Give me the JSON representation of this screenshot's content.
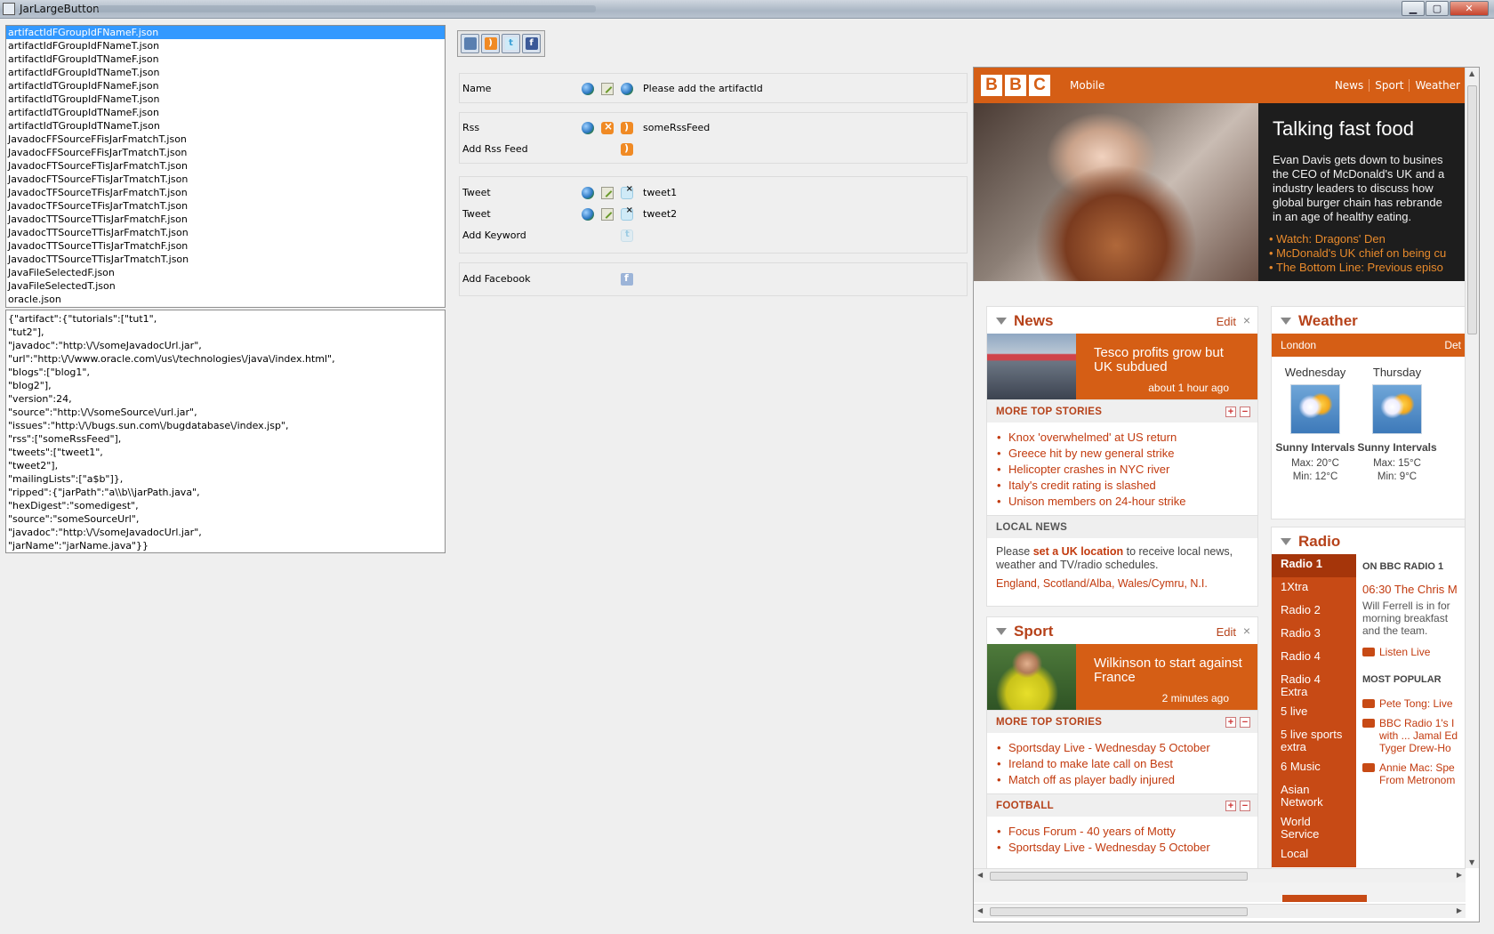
{
  "window": {
    "title": "JarLargeButton",
    "controls": {
      "minimize": "▁",
      "maximize": "▢",
      "close": "✕"
    }
  },
  "file_list": {
    "selected_index": 0,
    "items": [
      "artifactIdFGroupIdFNameF.json",
      "artifactIdFGroupIdFNameT.json",
      "artifactIdFGroupIdTNameF.json",
      "artifactIdFGroupIdTNameT.json",
      "artifactIdTGroupIdFNameF.json",
      "artifactIdTGroupIdFNameT.json",
      "artifactIdTGroupIdTNameF.json",
      "artifactIdTGroupIdTNameT.json",
      "JavadocFFSourceFFisJarFmatchT.json",
      "JavadocFFSourceFFisJarTmatchT.json",
      "JavadocFTSourceFTisJarFmatchT.json",
      "JavadocFTSourceFTisJarTmatchT.json",
      "JavadocTFSourceTFisJarFmatchT.json",
      "JavadocTFSourceTFisJarTmatchT.json",
      "JavadocTTSourceTTisJarFmatchF.json",
      "JavadocTTSourceTTisJarFmatchT.json",
      "JavadocTTSourceTTisJarTmatchF.json",
      "JavadocTTSourceTTisJarTmatchT.json",
      "JavaFileSelectedF.json",
      "JavaFileSelectedT.json",
      "oracle.json"
    ]
  },
  "json_text": {
    "lines": [
      "{\"artifact\":{\"tutorials\":[\"tut1\",",
      "\"tut2\"],",
      "\"javadoc\":\"http:\\/\\/someJavadocUrl.jar\",",
      "\"url\":\"http:\\/\\/www.oracle.com\\/us\\/technologies\\/java\\/index.html\",",
      "\"blogs\":[\"blog1\",",
      "\"blog2\"],",
      "\"version\":24,",
      "\"source\":\"http:\\/\\/someSource\\/url.jar\",",
      "\"issues\":\"http:\\/\\/bugs.sun.com\\/bugdatabase\\/index.jsp\",",
      "\"rss\":[\"someRssFeed\"],",
      "\"tweets\":[\"tweet1\",",
      "\"tweet2\"],",
      "\"mailingLists\":[\"a$b\"]},",
      "\"ripped\":{\"jarPath\":\"a\\\\b\\\\jarPath.java\",",
      "\"hexDigest\":\"somedigest\",",
      "\"source\":\"someSourceUrl\",",
      "\"javadoc\":\"http:\\/\\/someJavadocUrl.jar\",",
      "\"jarName\":\"jarName.java\"}}"
    ]
  },
  "toolbar": {
    "buttons": [
      "edit-icon",
      "rss-icon",
      "twitter-icon",
      "facebook-icon"
    ],
    "glyphs": {
      "rss": ")",
      "twitter": "t",
      "facebook": "f"
    }
  },
  "form": {
    "name": {
      "label": "Name",
      "value": "Please add the artifactId"
    },
    "rss": {
      "label": "Rss",
      "value": "someRssFeed",
      "add_label": "Add Rss Feed"
    },
    "tweets": [
      {
        "label": "Tweet",
        "value": "tweet1"
      },
      {
        "label": "Tweet",
        "value": "tweet2"
      }
    ],
    "add_keyword": "Add Keyword",
    "add_facebook": "Add Facebook"
  },
  "bbc": {
    "logo": [
      "B",
      "B",
      "C"
    ],
    "mobile": "Mobile",
    "nav": [
      "News",
      "Sport",
      "Weather"
    ],
    "hero": {
      "title": "Talking fast food",
      "text_lines": [
        "Evan Davis gets down to busines",
        "the CEO of McDonald's UK and a",
        "industry leaders to discuss how",
        "global burger chain has rebrande",
        "in an age of healthy eating."
      ],
      "links": [
        "Watch: Dragons' Den",
        "McDonald's UK chief on being cu",
        "The Bottom Line: Previous episo"
      ]
    },
    "news": {
      "title": "News",
      "edit": "Edit",
      "close": "×",
      "feature_headline": "Tesco profits grow but UK subdued",
      "feature_age": "about 1 hour ago",
      "more_label": "MORE  TOP STORIES",
      "stories": [
        "Knox 'overwhelmed' at US return",
        "Greece hit by new general strike",
        "Helicopter crashes in NYC river",
        "Italy's credit rating is slashed",
        "Unison members on 24-hour strike"
      ],
      "local_label": "LOCAL NEWS",
      "local_pre": "Please ",
      "local_link": "set a UK location",
      "local_post": " to receive local news, weather and TV/radio schedules.",
      "local_regions": "England, Scotland/Alba, Wales/Cymru, N.I."
    },
    "sport": {
      "title": "Sport",
      "edit": "Edit",
      "close": "×",
      "feature_headline": "Wilkinson to start against France",
      "feature_age": "2 minutes ago",
      "more_label": "MORE TOP STORIES",
      "stories": [
        "Sportsday Live - Wednesday 5 October",
        "Ireland to make late call on Best",
        "Match off as player badly injured"
      ],
      "football_label": "FOOTBALL",
      "football_stories": [
        "Focus Forum - 40 years of Motty",
        "Sportsday Live - Wednesday 5 October"
      ]
    },
    "weather": {
      "title": "Weather",
      "location": "London",
      "location_right": "Det",
      "days": [
        {
          "day": "Wednesday",
          "desc": "Sunny Intervals",
          "max": "Max: 20°C",
          "min": "Min: 12°C"
        },
        {
          "day": "Thursday",
          "desc": "Sunny Intervals",
          "max": "Max: 15°C",
          "min": "Min: 9°C"
        }
      ]
    },
    "radio": {
      "title": "Radio",
      "stations": [
        "Radio 1",
        "1Xtra",
        "Radio 2",
        "Radio 3",
        "Radio 4",
        "Radio 4 Extra",
        "5 live",
        "5 live sports extra",
        "6 Music",
        "Asian Network",
        "World Service",
        "Local"
      ],
      "on_air_label": "ON BBC RADIO 1",
      "show": "06:30 The Chris M",
      "show_desc": [
        "Will Ferrell is in for",
        "morning breakfast",
        "and the team."
      ],
      "listen_live": "Listen Live",
      "most_popular_label": "MOST POPULAR",
      "popular": [
        "Pete Tong: Live",
        "BBC Radio 1's I",
        "with ... Jamal Ed",
        "Tyger Drew-Ho",
        "Annie Mac: Spe",
        "From Metronom"
      ]
    }
  }
}
